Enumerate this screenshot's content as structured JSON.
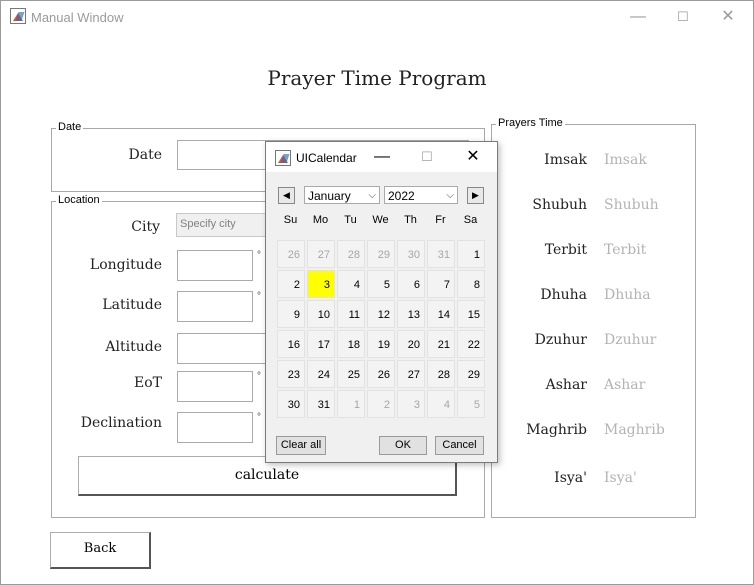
{
  "window": {
    "title": "Manual Window",
    "minimize_glyph": "—",
    "maximize_glyph": "☐",
    "close_glyph": "✕"
  },
  "app": {
    "title": "Prayer Time Program",
    "back_label": "Back",
    "calculate_label": "calculate"
  },
  "date_panel": {
    "title": "Date",
    "date_label": "Date",
    "date_value": ""
  },
  "location_panel": {
    "title": "Location",
    "city_label": "City",
    "city_placeholder": "Specify city",
    "longitude_label": "Longitude",
    "latitude_label": "Latitude",
    "altitude_label": "Altitude",
    "eot_label": "EoT",
    "declination_label": "Declination",
    "degree_symbol": "°"
  },
  "prayers_panel": {
    "title": "Prayers Time",
    "items": [
      {
        "label": "Imsak",
        "value": "Imsak"
      },
      {
        "label": "Shubuh",
        "value": "Shubuh"
      },
      {
        "label": "Terbit",
        "value": "Terbit"
      },
      {
        "label": "Dhuha",
        "value": "Dhuha"
      },
      {
        "label": "Dzuhur",
        "value": "Dzuhur"
      },
      {
        "label": "Ashar",
        "value": "Ashar"
      },
      {
        "label": "Maghrib",
        "value": "Maghrib"
      },
      {
        "label": "Isya'",
        "value": "Isya'"
      }
    ]
  },
  "calendar": {
    "title": "UICalendar",
    "prev_glyph": "◀",
    "next_glyph": "▶",
    "month": "January",
    "year": "2022",
    "day_headers": [
      "Su",
      "Mo",
      "Tu",
      "We",
      "Th",
      "Fr",
      "Sa"
    ],
    "weeks": [
      [
        {
          "d": "26",
          "out": true
        },
        {
          "d": "27",
          "out": true
        },
        {
          "d": "28",
          "out": true
        },
        {
          "d": "29",
          "out": true
        },
        {
          "d": "30",
          "out": true
        },
        {
          "d": "31",
          "out": true
        },
        {
          "d": "1"
        }
      ],
      [
        {
          "d": "2"
        },
        {
          "d": "3",
          "selected": true
        },
        {
          "d": "4"
        },
        {
          "d": "5"
        },
        {
          "d": "6"
        },
        {
          "d": "7"
        },
        {
          "d": "8"
        }
      ],
      [
        {
          "d": "9"
        },
        {
          "d": "10"
        },
        {
          "d": "11"
        },
        {
          "d": "12"
        },
        {
          "d": "13"
        },
        {
          "d": "14"
        },
        {
          "d": "15"
        }
      ],
      [
        {
          "d": "16"
        },
        {
          "d": "17"
        },
        {
          "d": "18"
        },
        {
          "d": "19"
        },
        {
          "d": "20"
        },
        {
          "d": "21"
        },
        {
          "d": "22"
        }
      ],
      [
        {
          "d": "23"
        },
        {
          "d": "24"
        },
        {
          "d": "25"
        },
        {
          "d": "26"
        },
        {
          "d": "27"
        },
        {
          "d": "28"
        },
        {
          "d": "29"
        }
      ],
      [
        {
          "d": "30"
        },
        {
          "d": "31"
        },
        {
          "d": "1",
          "out": true
        },
        {
          "d": "2",
          "out": true
        },
        {
          "d": "3",
          "out": true
        },
        {
          "d": "4",
          "out": true
        },
        {
          "d": "5",
          "out": true
        }
      ]
    ],
    "clear_label": "Clear all",
    "ok_label": "OK",
    "cancel_label": "Cancel",
    "selected_color": "#ffff00"
  }
}
